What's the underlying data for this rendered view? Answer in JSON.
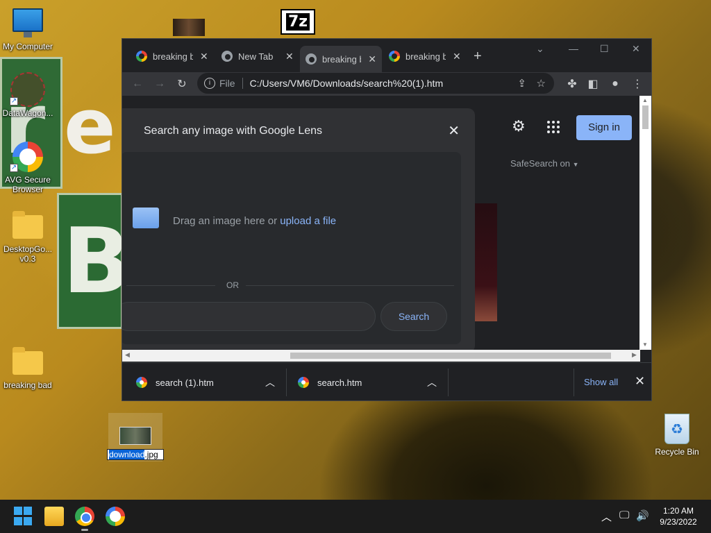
{
  "desktop": {
    "icons": {
      "my_computer": "My Computer",
      "datawagon": "DataWagon...",
      "avg": "AVG Secure Browser",
      "desktopgo": "DesktopGo... v0.3",
      "breaking_bad": "breaking bad",
      "recycle_bin": "Recycle Bin"
    },
    "rename_selected": "download",
    "rename_rest": ".jpg",
    "sevenz_label": "7z"
  },
  "browser": {
    "tabs": [
      {
        "title": "breaking b",
        "favicon": "google-icon"
      },
      {
        "title": "New Tab",
        "favicon": "chrome-icon"
      },
      {
        "title": "breaking b",
        "favicon": "chrome-icon",
        "active": true
      },
      {
        "title": "breaking b",
        "favicon": "google-icon"
      }
    ],
    "address": {
      "scheme": "File",
      "url": "C:/Users/VM6/Downloads/search%20(1).htm"
    },
    "page": {
      "sign_in": "Sign in",
      "safesearch": "SafeSearch on"
    },
    "lens": {
      "title": "Search any image with Google Lens",
      "drag_text": "Drag an image here or ",
      "upload_link": "upload a file",
      "or": "OR",
      "search_button": "Search"
    },
    "downloads": {
      "items": [
        "search (1).htm",
        "search.htm"
      ],
      "show_all": "Show all"
    }
  },
  "taskbar": {
    "time": "1:20 AM",
    "date": "9/23/2022"
  },
  "colors": {
    "accent": "#8ab4f8",
    "dark_bg": "#202124",
    "panel": "#303134"
  }
}
